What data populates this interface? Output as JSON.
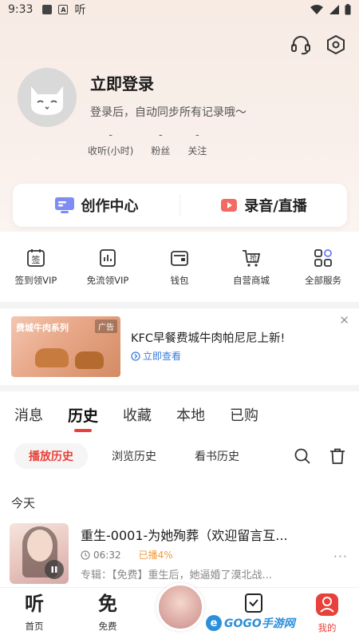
{
  "status_bar": {
    "time": "9:33",
    "app_glyph": "听",
    "a_badge": "A"
  },
  "profile": {
    "title": "立即登录",
    "subtitle": "登录后，自动同步所有记录哦～",
    "stats": [
      {
        "value": "-",
        "label": "收听(小时)"
      },
      {
        "value": "-",
        "label": "粉丝"
      },
      {
        "value": "-",
        "label": "关注"
      }
    ]
  },
  "create": {
    "left_label": "创作中心",
    "right_label": "录音/直播"
  },
  "services": [
    {
      "label": "签到领VIP",
      "icon": "sign-in-icon",
      "glyph": "签"
    },
    {
      "label": "免流领VIP",
      "icon": "data-free-icon",
      "glyph": ""
    },
    {
      "label": "钱包",
      "icon": "wallet-icon",
      "glyph": ""
    },
    {
      "label": "自营商城",
      "icon": "shop-cart-icon",
      "glyph": "抢"
    },
    {
      "label": "全部服务",
      "icon": "all-services-icon",
      "glyph": ""
    }
  ],
  "ad": {
    "image_brand": "费城牛肉系列",
    "tag": "广告",
    "title": "KFC早餐费城牛肉帕尼尼上新!",
    "link": "立即查看"
  },
  "tabs": [
    "消息",
    "历史",
    "收藏",
    "本地",
    "已购"
  ],
  "active_tab": "历史",
  "subtabs": [
    "播放历史",
    "浏览历史",
    "看书历史"
  ],
  "active_subtab": "播放历史",
  "section_header": "今天",
  "history_item": {
    "title": "重生-0001-为她殉葬（欢迎留言互...",
    "duration": "06:32",
    "played": "已播4%",
    "album": "专辑：【免费】重生后，她逼婚了漠北战...",
    "more": "···"
  },
  "bottom_nav": [
    {
      "label": "首页",
      "glyph": "听"
    },
    {
      "label": "免费",
      "glyph": "免"
    },
    {
      "label": "",
      "glyph": ""
    },
    {
      "label": "",
      "glyph": ""
    },
    {
      "label": "我的",
      "glyph": ""
    }
  ],
  "watermark": {
    "text": "GOGO手游网",
    "e": "e"
  },
  "colors": {
    "accent": "#e8403a",
    "link": "#3b7dd8",
    "played": "#f09a3e"
  }
}
